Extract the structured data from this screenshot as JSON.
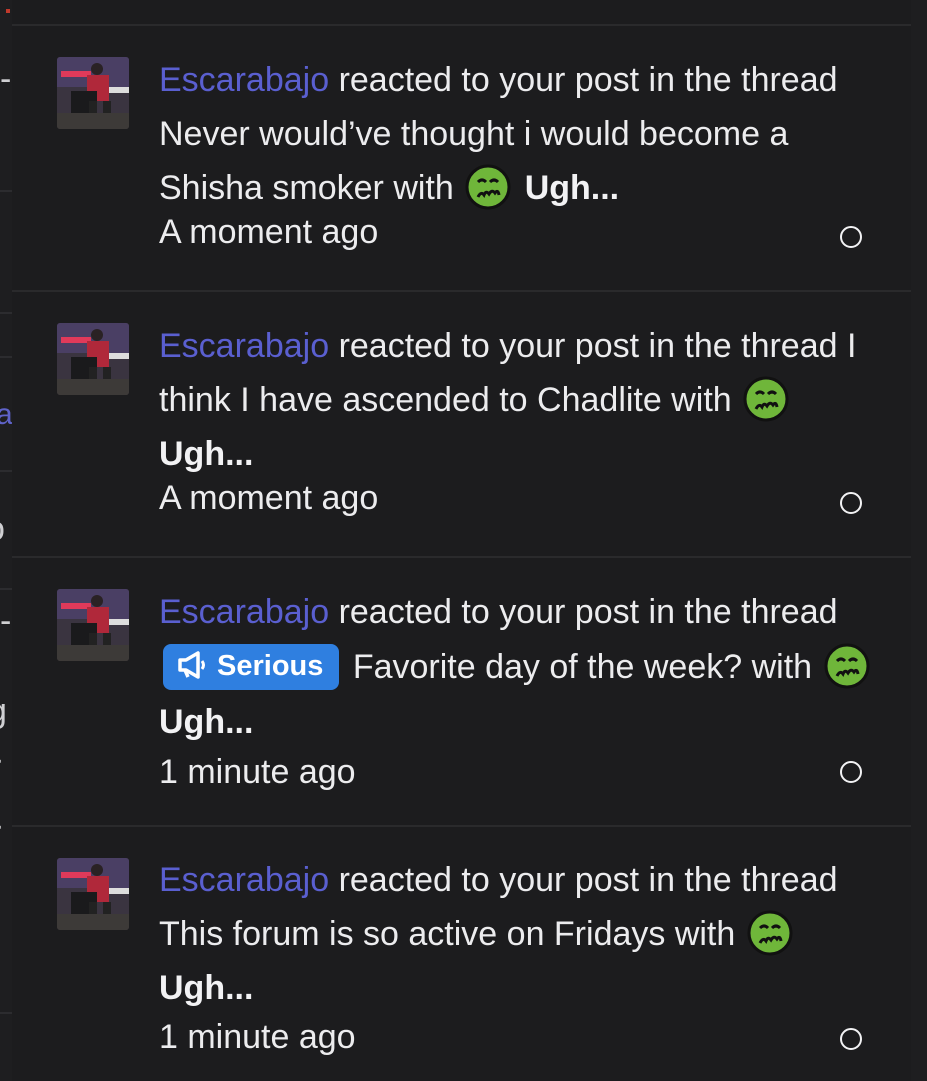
{
  "notifications": [
    {
      "user": "Escarabajo",
      "text_before": "reacted to your post in the thread Never would’ve thought i would become a Shisha smoker with",
      "reaction": "Ugh...",
      "time": "A moment ago"
    },
    {
      "user": "Escarabajo",
      "text_before": "reacted to your post in the thread I think I have ascended to Chadlite with",
      "reaction": "Ugh...",
      "time": "A moment ago"
    },
    {
      "user": "Escarabajo",
      "text_a": "reacted to your post in the thread",
      "prefix": "Serious",
      "text_b": "Favorite day of the week? with",
      "reaction": "Ugh...",
      "time": "1 minute ago"
    },
    {
      "user": "Escarabajo",
      "text_before": "reacted to your post in the thread This forum is so active on Fridays with",
      "reaction": "Ugh...",
      "time": "1 minute ago"
    }
  ],
  "background_fragments": [
    "-",
    "ai",
    "o",
    "-",
    "g",
    "r",
    "r"
  ],
  "icons": {
    "avatar": "user-avatar",
    "reaction": "nauseated-face-icon",
    "prefix": "megaphone-icon",
    "mark_read": "circle-outline-icon"
  },
  "colors": {
    "username": "#5a5fd0",
    "prefix_badge": "#2f7fe0",
    "reaction_face": "#6fb63a"
  }
}
